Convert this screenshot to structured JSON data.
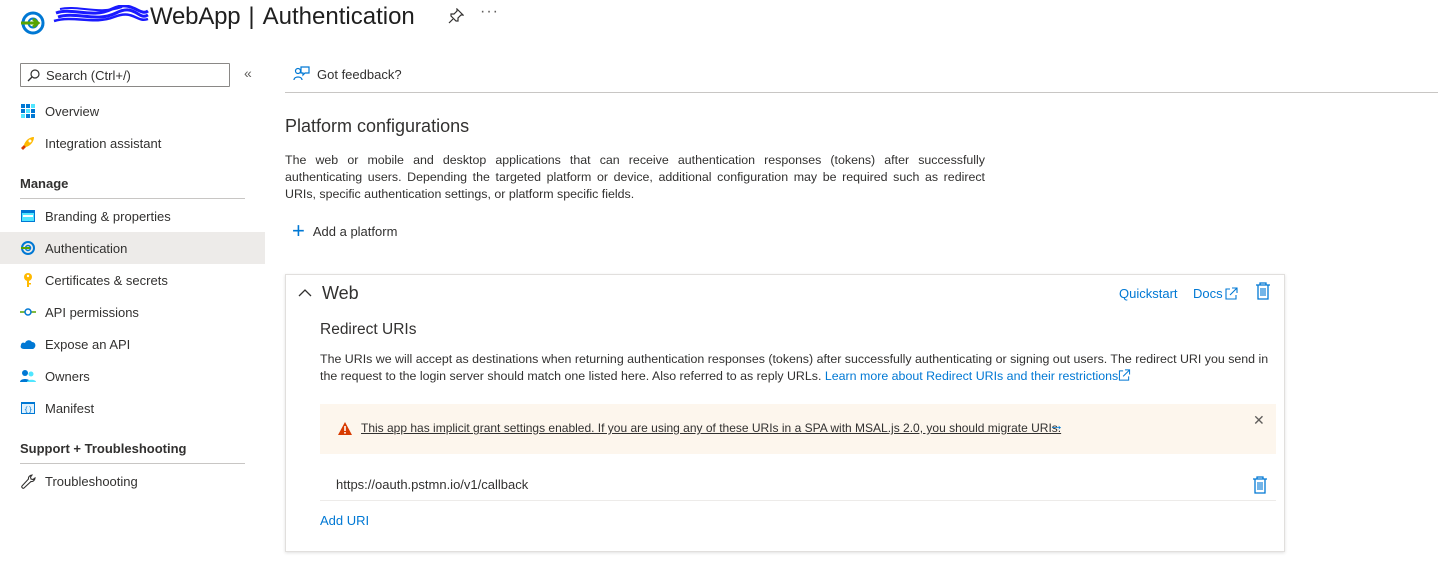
{
  "header": {
    "app_name": "WebApp",
    "separator": "|",
    "page_title": "Authentication",
    "more": "···"
  },
  "sidebar": {
    "search_placeholder": "Search (Ctrl+/)",
    "collapse": "«",
    "items_top": [
      {
        "label": "Overview",
        "icon": "overview-icon"
      },
      {
        "label": "Integration assistant",
        "icon": "rocket-icon"
      }
    ],
    "manage_heading": "Manage",
    "manage_items": [
      {
        "label": "Branding & properties",
        "icon": "branding-icon"
      },
      {
        "label": "Authentication",
        "icon": "authentication-icon",
        "active": true
      },
      {
        "label": "Certificates & secrets",
        "icon": "key-icon"
      },
      {
        "label": "API permissions",
        "icon": "api-permissions-icon"
      },
      {
        "label": "Expose an API",
        "icon": "cloud-icon"
      },
      {
        "label": "Owners",
        "icon": "owners-icon"
      },
      {
        "label": "Manifest",
        "icon": "manifest-icon"
      }
    ],
    "support_heading": "Support + Troubleshooting",
    "support_items": [
      {
        "label": "Troubleshooting",
        "icon": "wrench-icon"
      }
    ]
  },
  "main": {
    "feedback": "Got feedback?",
    "platform_title": "Platform configurations",
    "platform_desc": "The web or mobile and desktop applications that can receive authentication responses (tokens) after successfully authenticating users. Depending the targeted platform or device, additional configuration may be required such as redirect URIs, specific authentication settings, or platform specific fields.",
    "add_platform": "Add a platform",
    "web_card": {
      "title": "Web",
      "quickstart": "Quickstart",
      "docs": "Docs",
      "redirect_title": "Redirect URIs",
      "redirect_desc": "The URIs we will accept as destinations when returning authentication responses (tokens) after successfully authenticating or signing out users. The redirect URI you send in the request to the login server should match one listed here. Also referred to as reply URLs.",
      "learn_more": "Learn more about Redirect URIs and their restrictions",
      "warning_text": "This app has implicit grant settings enabled. If you are using any of these URIs in a SPA with MSAL.js 2.0, you should migrate URIs.",
      "warning_arrow": "→",
      "warning_close": "✕",
      "uris": [
        "https://oauth.pstmn.io/v1/callback"
      ],
      "add_uri": "Add URI"
    }
  },
  "colors": {
    "accent": "#0078d4",
    "warning_bg": "#fdf6ed",
    "warning_icon": "#d83b01",
    "active_nav_bg": "#edebe9"
  }
}
